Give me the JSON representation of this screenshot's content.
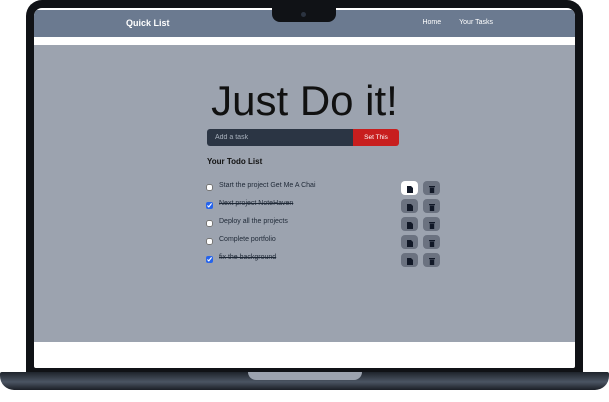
{
  "navbar": {
    "brand": "Quick List",
    "links": [
      "Home",
      "Your Tasks"
    ]
  },
  "hero": {
    "title": "Just Do it!"
  },
  "task_form": {
    "placeholder": "Add a task",
    "value": "",
    "save_label": "Set This"
  },
  "todo_list": {
    "title": "Your Todo List",
    "items": [
      {
        "text": "Start the project Get Me A Chai",
        "completed": false
      },
      {
        "text": "Next project NoteHaven",
        "completed": true
      },
      {
        "text": "Deploy all the projects",
        "completed": false
      },
      {
        "text": "Complete portfolio",
        "completed": false
      },
      {
        "text": "fix the background",
        "completed": true
      }
    ]
  },
  "colors": {
    "navbar": "#6b7a90",
    "background": "#9ca3af",
    "input": "#2b3544",
    "save_button": "#c81e1e",
    "action_button": "#6b7280"
  },
  "icons": {
    "edit": "edit-icon",
    "delete": "trash-icon"
  }
}
